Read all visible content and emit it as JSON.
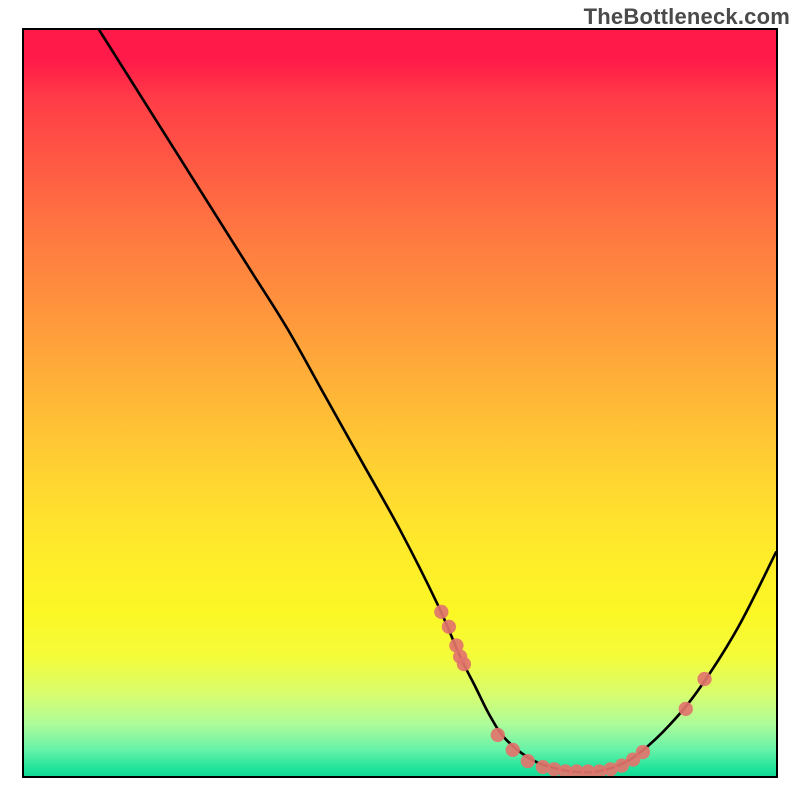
{
  "watermark": "TheBottleneck.com",
  "chart_data": {
    "type": "line",
    "title": "",
    "xlabel": "",
    "ylabel": "",
    "xlim": [
      0,
      100
    ],
    "ylim": [
      0,
      100
    ],
    "grid": false,
    "curve": {
      "x": [
        10,
        15,
        20,
        25,
        30,
        35,
        40,
        45,
        50,
        55,
        58,
        60,
        62,
        64,
        67,
        70,
        73,
        76,
        79,
        82,
        86,
        90,
        95,
        100
      ],
      "y": [
        100,
        92,
        84,
        76,
        68,
        60,
        51,
        42,
        33,
        23,
        16,
        12,
        8,
        5,
        2.5,
        1.2,
        0.6,
        0.6,
        1.4,
        3.2,
        7,
        12,
        20,
        30
      ]
    },
    "points": {
      "color": "#e2746d",
      "x": [
        55.5,
        56.5,
        57.5,
        58.0,
        58.5,
        63.0,
        65.0,
        67.0,
        69.0,
        70.5,
        72.0,
        73.5,
        75.0,
        76.5,
        78.0,
        79.5,
        81.0,
        82.3,
        88.0,
        90.5
      ],
      "y": [
        22.0,
        20.0,
        17.5,
        16.0,
        15.0,
        5.5,
        3.5,
        2.0,
        1.2,
        0.9,
        0.6,
        0.6,
        0.6,
        0.6,
        0.9,
        1.4,
        2.2,
        3.2,
        9.0,
        13.0
      ]
    },
    "gradient_stops": [
      {
        "pct": 0,
        "color": "#ff1a49"
      },
      {
        "pct": 4,
        "color": "#ff1a49"
      },
      {
        "pct": 9,
        "color": "#ff3b47"
      },
      {
        "pct": 18,
        "color": "#ff5a44"
      },
      {
        "pct": 28,
        "color": "#ff7a41"
      },
      {
        "pct": 38,
        "color": "#ff963d"
      },
      {
        "pct": 48,
        "color": "#ffb338"
      },
      {
        "pct": 58,
        "color": "#ffcf32"
      },
      {
        "pct": 68,
        "color": "#ffe82c"
      },
      {
        "pct": 78,
        "color": "#fcf725"
      },
      {
        "pct": 84,
        "color": "#f4fc3a"
      },
      {
        "pct": 89,
        "color": "#d8fd6e"
      },
      {
        "pct": 93,
        "color": "#aefc9a"
      },
      {
        "pct": 96.5,
        "color": "#66f2a8"
      },
      {
        "pct": 99,
        "color": "#20e39b"
      },
      {
        "pct": 100,
        "color": "#13db95"
      }
    ]
  }
}
